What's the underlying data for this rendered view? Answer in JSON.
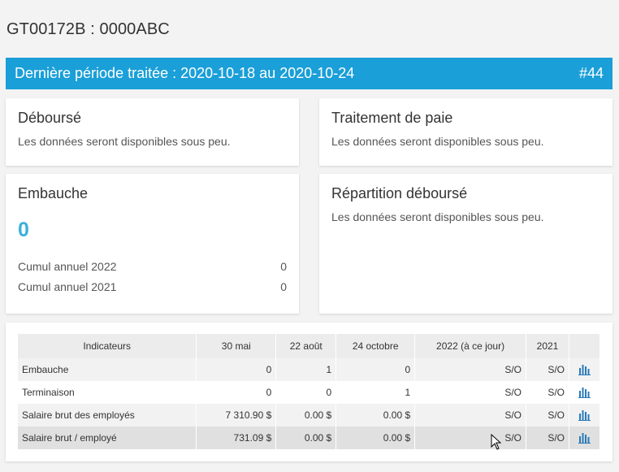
{
  "header": {
    "title": "GT00172B : 0000ABC"
  },
  "period": {
    "label": "Dernière période traitée : 2020-10-18 au 2020-10-24",
    "number": "#44"
  },
  "cards": {
    "debourse": {
      "title": "Déboursé",
      "message": "Les données seront disponibles sous peu."
    },
    "traitement": {
      "title": "Traitement de paie",
      "message": "Les données seront disponibles sous peu."
    },
    "embauche": {
      "title": "Embauche",
      "value": "0",
      "cumuls": [
        {
          "label": "Cumul annuel 2022",
          "value": "0"
        },
        {
          "label": "Cumul annuel 2021",
          "value": "0"
        }
      ]
    },
    "repartition": {
      "title": "Répartition déboursé",
      "message": "Les données seront disponibles sous peu."
    }
  },
  "table": {
    "headers": [
      "Indicateurs",
      "30 mai",
      "22 août",
      "24 octobre",
      "2022 (à ce jour)",
      "2021"
    ],
    "rows": [
      {
        "name": "Embauche",
        "values": [
          "0",
          "1",
          "0",
          "S/O",
          "S/O"
        ]
      },
      {
        "name": "Terminaison",
        "values": [
          "0",
          "0",
          "1",
          "S/O",
          "S/O"
        ]
      },
      {
        "name": "Salaire brut des employés",
        "values": [
          "7 310.90 $",
          "0.00 $",
          "0.00 $",
          "S/O",
          "S/O"
        ]
      },
      {
        "name": "Salaire brut / employé",
        "values": [
          "731.09 $",
          "0.00 $",
          "0.00 $",
          "S/O",
          "S/O"
        ]
      }
    ],
    "row_icon": "bar-chart-icon"
  },
  "colors": {
    "accent": "#1a9fd8",
    "big_number": "#3ab0dd",
    "icon": "#2a7ab8"
  }
}
